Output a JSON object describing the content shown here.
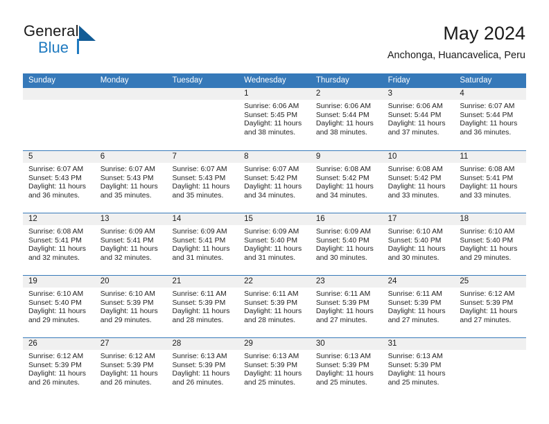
{
  "brand": {
    "name_part1": "General",
    "name_part2": "Blue"
  },
  "header": {
    "title": "May 2024",
    "location": "Anchonga, Huancavelica, Peru"
  },
  "colors": {
    "header_blue": "#3679b9",
    "brand_blue": "#1f7ac0",
    "brand_dark_blue": "#125c96",
    "day_band_gray": "#f0f0f0"
  },
  "weekdays": [
    "Sunday",
    "Monday",
    "Tuesday",
    "Wednesday",
    "Thursday",
    "Friday",
    "Saturday"
  ],
  "labels": {
    "sunrise_prefix": "Sunrise:",
    "sunset_prefix": "Sunset:",
    "daylight_prefix": "Daylight:"
  },
  "weeks": [
    [
      {
        "day": "",
        "lines": []
      },
      {
        "day": "",
        "lines": []
      },
      {
        "day": "",
        "lines": []
      },
      {
        "day": "1",
        "lines": [
          "Sunrise: 6:06 AM",
          "Sunset: 5:45 PM",
          "Daylight: 11 hours",
          "and 38 minutes."
        ]
      },
      {
        "day": "2",
        "lines": [
          "Sunrise: 6:06 AM",
          "Sunset: 5:44 PM",
          "Daylight: 11 hours",
          "and 38 minutes."
        ]
      },
      {
        "day": "3",
        "lines": [
          "Sunrise: 6:06 AM",
          "Sunset: 5:44 PM",
          "Daylight: 11 hours",
          "and 37 minutes."
        ]
      },
      {
        "day": "4",
        "lines": [
          "Sunrise: 6:07 AM",
          "Sunset: 5:44 PM",
          "Daylight: 11 hours",
          "and 36 minutes."
        ]
      }
    ],
    [
      {
        "day": "5",
        "lines": [
          "Sunrise: 6:07 AM",
          "Sunset: 5:43 PM",
          "Daylight: 11 hours",
          "and 36 minutes."
        ]
      },
      {
        "day": "6",
        "lines": [
          "Sunrise: 6:07 AM",
          "Sunset: 5:43 PM",
          "Daylight: 11 hours",
          "and 35 minutes."
        ]
      },
      {
        "day": "7",
        "lines": [
          "Sunrise: 6:07 AM",
          "Sunset: 5:43 PM",
          "Daylight: 11 hours",
          "and 35 minutes."
        ]
      },
      {
        "day": "8",
        "lines": [
          "Sunrise: 6:07 AM",
          "Sunset: 5:42 PM",
          "Daylight: 11 hours",
          "and 34 minutes."
        ]
      },
      {
        "day": "9",
        "lines": [
          "Sunrise: 6:08 AM",
          "Sunset: 5:42 PM",
          "Daylight: 11 hours",
          "and 34 minutes."
        ]
      },
      {
        "day": "10",
        "lines": [
          "Sunrise: 6:08 AM",
          "Sunset: 5:42 PM",
          "Daylight: 11 hours",
          "and 33 minutes."
        ]
      },
      {
        "day": "11",
        "lines": [
          "Sunrise: 6:08 AM",
          "Sunset: 5:41 PM",
          "Daylight: 11 hours",
          "and 33 minutes."
        ]
      }
    ],
    [
      {
        "day": "12",
        "lines": [
          "Sunrise: 6:08 AM",
          "Sunset: 5:41 PM",
          "Daylight: 11 hours",
          "and 32 minutes."
        ]
      },
      {
        "day": "13",
        "lines": [
          "Sunrise: 6:09 AM",
          "Sunset: 5:41 PM",
          "Daylight: 11 hours",
          "and 32 minutes."
        ]
      },
      {
        "day": "14",
        "lines": [
          "Sunrise: 6:09 AM",
          "Sunset: 5:41 PM",
          "Daylight: 11 hours",
          "and 31 minutes."
        ]
      },
      {
        "day": "15",
        "lines": [
          "Sunrise: 6:09 AM",
          "Sunset: 5:40 PM",
          "Daylight: 11 hours",
          "and 31 minutes."
        ]
      },
      {
        "day": "16",
        "lines": [
          "Sunrise: 6:09 AM",
          "Sunset: 5:40 PM",
          "Daylight: 11 hours",
          "and 30 minutes."
        ]
      },
      {
        "day": "17",
        "lines": [
          "Sunrise: 6:10 AM",
          "Sunset: 5:40 PM",
          "Daylight: 11 hours",
          "and 30 minutes."
        ]
      },
      {
        "day": "18",
        "lines": [
          "Sunrise: 6:10 AM",
          "Sunset: 5:40 PM",
          "Daylight: 11 hours",
          "and 29 minutes."
        ]
      }
    ],
    [
      {
        "day": "19",
        "lines": [
          "Sunrise: 6:10 AM",
          "Sunset: 5:40 PM",
          "Daylight: 11 hours",
          "and 29 minutes."
        ]
      },
      {
        "day": "20",
        "lines": [
          "Sunrise: 6:10 AM",
          "Sunset: 5:39 PM",
          "Daylight: 11 hours",
          "and 29 minutes."
        ]
      },
      {
        "day": "21",
        "lines": [
          "Sunrise: 6:11 AM",
          "Sunset: 5:39 PM",
          "Daylight: 11 hours",
          "and 28 minutes."
        ]
      },
      {
        "day": "22",
        "lines": [
          "Sunrise: 6:11 AM",
          "Sunset: 5:39 PM",
          "Daylight: 11 hours",
          "and 28 minutes."
        ]
      },
      {
        "day": "23",
        "lines": [
          "Sunrise: 6:11 AM",
          "Sunset: 5:39 PM",
          "Daylight: 11 hours",
          "and 27 minutes."
        ]
      },
      {
        "day": "24",
        "lines": [
          "Sunrise: 6:11 AM",
          "Sunset: 5:39 PM",
          "Daylight: 11 hours",
          "and 27 minutes."
        ]
      },
      {
        "day": "25",
        "lines": [
          "Sunrise: 6:12 AM",
          "Sunset: 5:39 PM",
          "Daylight: 11 hours",
          "and 27 minutes."
        ]
      }
    ],
    [
      {
        "day": "26",
        "lines": [
          "Sunrise: 6:12 AM",
          "Sunset: 5:39 PM",
          "Daylight: 11 hours",
          "and 26 minutes."
        ]
      },
      {
        "day": "27",
        "lines": [
          "Sunrise: 6:12 AM",
          "Sunset: 5:39 PM",
          "Daylight: 11 hours",
          "and 26 minutes."
        ]
      },
      {
        "day": "28",
        "lines": [
          "Sunrise: 6:13 AM",
          "Sunset: 5:39 PM",
          "Daylight: 11 hours",
          "and 26 minutes."
        ]
      },
      {
        "day": "29",
        "lines": [
          "Sunrise: 6:13 AM",
          "Sunset: 5:39 PM",
          "Daylight: 11 hours",
          "and 25 minutes."
        ]
      },
      {
        "day": "30",
        "lines": [
          "Sunrise: 6:13 AM",
          "Sunset: 5:39 PM",
          "Daylight: 11 hours",
          "and 25 minutes."
        ]
      },
      {
        "day": "31",
        "lines": [
          "Sunrise: 6:13 AM",
          "Sunset: 5:39 PM",
          "Daylight: 11 hours",
          "and 25 minutes."
        ]
      },
      {
        "day": "",
        "lines": []
      }
    ]
  ]
}
